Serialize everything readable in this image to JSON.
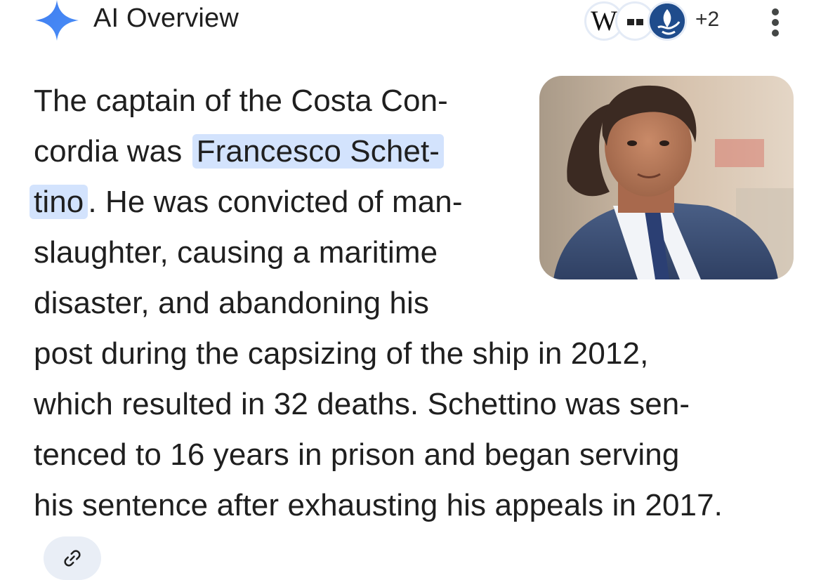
{
  "header": {
    "title": "AI Overview",
    "sources_more": "+2",
    "icons": [
      "sparkle-icon",
      "wikipedia-icon",
      "source-dots-icon",
      "source-seal-icon",
      "more-vert-icon"
    ]
  },
  "answer": {
    "lines": [
      {
        "before": "The captain of the Costa Con-",
        "highlight": "",
        "after": ""
      },
      {
        "before": "cordia was ",
        "highlight": "Francesco Schet-",
        "after": ""
      },
      {
        "before": "",
        "highlight": "tino",
        "after": ". He was convicted of man-"
      },
      {
        "before": "slaughter, causing a maritime",
        "highlight": "",
        "after": ""
      },
      {
        "before": "disaster, and abandoning his",
        "highlight": "",
        "after": ""
      },
      {
        "before": "post during the capsizing of the ship in 2012,",
        "highlight": "",
        "after": ""
      },
      {
        "before": "which resulted in 32 deaths. Schettino was sen-",
        "highlight": "",
        "after": ""
      },
      {
        "before": "tenced to 16 years in prison and began serving",
        "highlight": "",
        "after": ""
      },
      {
        "before": "his sentence after exhausting his appeals in 2017.",
        "highlight": "",
        "after": ""
      }
    ]
  },
  "footer": {
    "link_icon": "link-icon"
  },
  "colors": {
    "highlight": "#d3e3fd",
    "sparkle": "#4285f4",
    "chip": "#e9eef6",
    "text": "#1f1f1f"
  }
}
